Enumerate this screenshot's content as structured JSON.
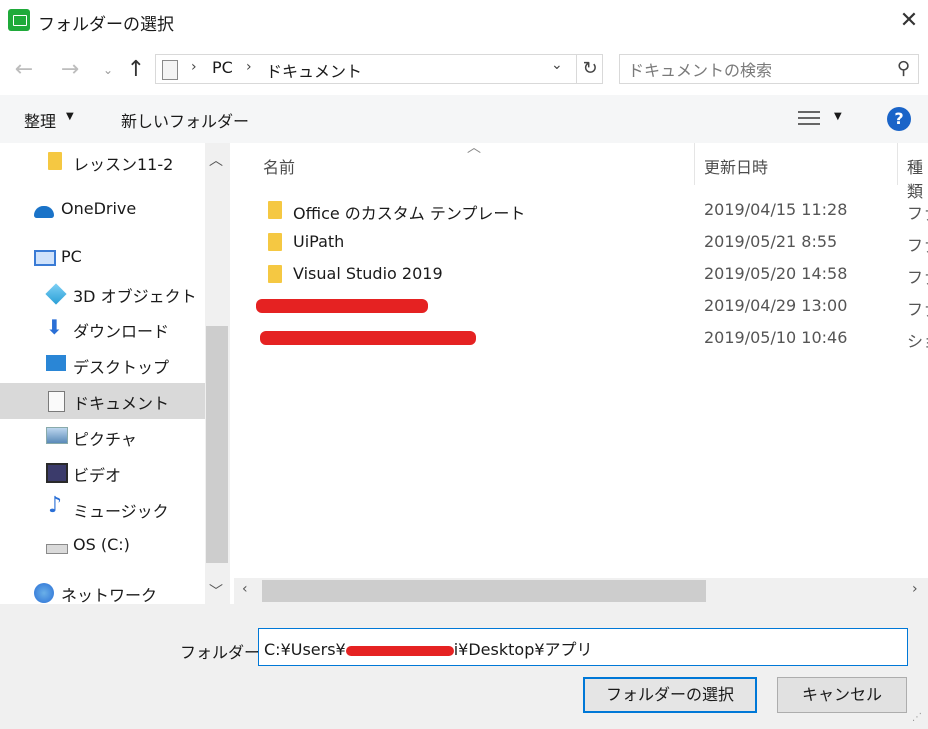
{
  "window": {
    "title": "フォルダーの選択"
  },
  "nav": {
    "breadcrumbs": [
      "PC",
      "ドキュメント"
    ],
    "search_placeholder": "ドキュメントの検索"
  },
  "toolbar": {
    "organize_label": "整理",
    "new_folder_label": "新しいフォルダー"
  },
  "sidebar": {
    "items": [
      {
        "label": "レッスン11-2",
        "icon": "folder-icon"
      },
      {
        "label": "OneDrive",
        "icon": "cloud-icon"
      },
      {
        "label": "PC",
        "icon": "computer-icon"
      },
      {
        "label": "3D オブジェクト",
        "icon": "cube-icon"
      },
      {
        "label": "ダウンロード",
        "icon": "download-icon"
      },
      {
        "label": "デスクトップ",
        "icon": "desktop-icon"
      },
      {
        "label": "ドキュメント",
        "icon": "document-icon",
        "selected": true
      },
      {
        "label": "ピクチャ",
        "icon": "picture-icon"
      },
      {
        "label": "ビデオ",
        "icon": "video-icon"
      },
      {
        "label": "ミュージック",
        "icon": "music-icon"
      },
      {
        "label": "OS (C:)",
        "icon": "drive-icon"
      },
      {
        "label": "ネットワーク",
        "icon": "network-icon"
      }
    ]
  },
  "file_list": {
    "columns": {
      "name": "名前",
      "modified": "更新日時",
      "type": "種類"
    },
    "rows": [
      {
        "name": "Office のカスタム テンプレート",
        "modified": "2019/04/15 11:28",
        "type": "ファ"
      },
      {
        "name": "UiPath",
        "modified": "2019/05/21 8:55",
        "type": "ファ"
      },
      {
        "name": "Visual Studio 2019",
        "modified": "2019/05/20 14:58",
        "type": "ファ"
      },
      {
        "name": "",
        "modified": "2019/04/29 13:00",
        "type": "ファ",
        "redacted": true
      },
      {
        "name": "",
        "modified": "2019/05/10 10:46",
        "type": "ショ",
        "redacted": true
      }
    ]
  },
  "footer": {
    "folder_label": "フォルダー:",
    "folder_value_prefix": "C:¥Users¥",
    "folder_value_suffix": "i¥Desktop¥アプリ",
    "select_button": "フォルダーの選択",
    "cancel_button": "キャンセル"
  },
  "colors": {
    "accent": "#0078d7",
    "redaction": "#e52222",
    "folder": "#f5c842"
  }
}
